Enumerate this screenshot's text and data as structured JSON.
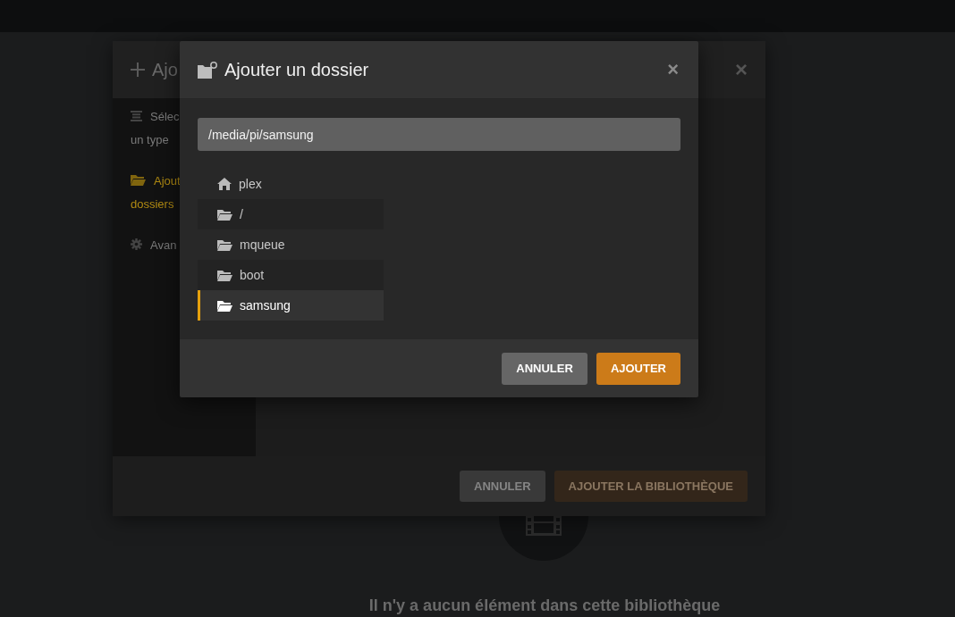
{
  "background_dialog": {
    "title": "Ajo",
    "close": "×",
    "sidebar": [
      {
        "kind": "list",
        "lines": [
          "Sélec",
          "un type"
        ],
        "selected": false
      },
      {
        "kind": "folder",
        "lines": [
          "Ajout",
          "dossiers"
        ],
        "selected": true
      },
      {
        "kind": "gear",
        "lines": [
          "Avan"
        ],
        "selected": false
      }
    ],
    "buttons": [
      {
        "kind": "secondary",
        "label": "ANNULER"
      },
      {
        "kind": "primary",
        "label": "AJOUTER LA BIBLIOTHÈQUE"
      }
    ]
  },
  "empty_state": {
    "message": "Il n'y a aucun élément dans cette bibliothèque"
  },
  "dialog": {
    "title": "Ajouter un dossier",
    "close": "×",
    "path": "/media/pi/samsung",
    "folders": [
      {
        "kind": "home",
        "name": "plex",
        "selected": false
      },
      {
        "kind": "folder",
        "name": "/",
        "selected": false
      },
      {
        "kind": "folder",
        "name": "mqueue",
        "selected": false
      },
      {
        "kind": "folder",
        "name": "boot",
        "selected": false
      },
      {
        "kind": "folder",
        "name": "samsung",
        "selected": true
      }
    ],
    "buttons": [
      {
        "kind": "secondary",
        "label": "ANNULER"
      },
      {
        "kind": "primary",
        "label": "AJOUTER"
      }
    ]
  }
}
